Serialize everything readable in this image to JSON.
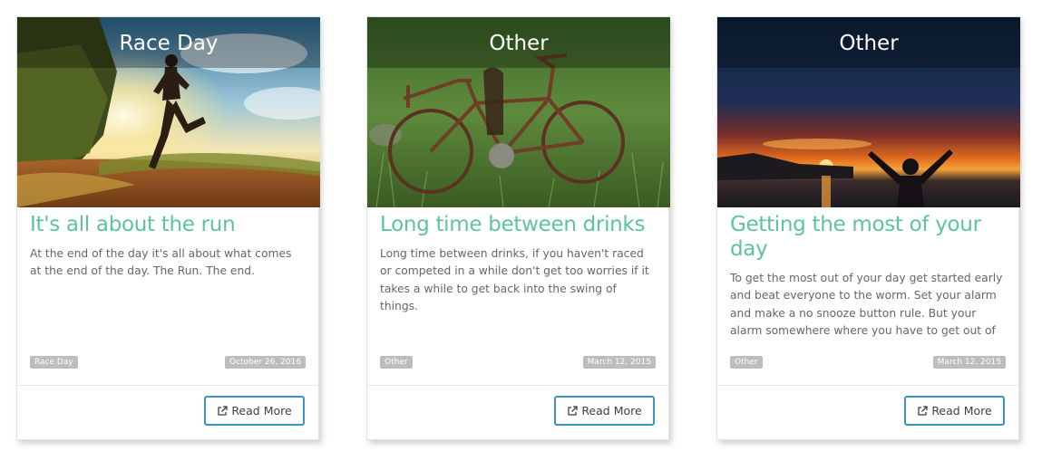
{
  "posts": [
    {
      "category": "Race Day",
      "title": "It's all about the run",
      "excerpt": "At the end of the day it's all about what comes at the end of the day. The Run. The end.",
      "tag": "Race Day",
      "date": "October 26, 2016",
      "button": "Read More",
      "image_icon": "runner-at-sunset-photo"
    },
    {
      "category": "Other",
      "title": "Long time between drinks",
      "excerpt": "Long time between drinks, if you haven't raced or competed in a while don't get too worries if it takes a while to get back into the swing of things.",
      "tag": "Other",
      "date": "March 12, 2015",
      "button": "Read More",
      "image_icon": "rusty-bicycle-photo"
    },
    {
      "category": "Other",
      "title": "Getting the most of your day",
      "excerpt": "To get the most out of your day get started early and beat everyone to the worm. Set your alarm and make a no snooze button rule. But your alarm somewhere where you have to get out of bed to actually turn it off.",
      "tag": "Other",
      "date": "March 12, 2015",
      "button": "Read More",
      "image_icon": "sunset-silhouette-photo"
    }
  ],
  "colors": {
    "title": "#5cc49c",
    "button_border": "#3a94c4",
    "tag_bg": "#bdbdbd"
  },
  "icons": {
    "read_more": "external-link-icon"
  }
}
